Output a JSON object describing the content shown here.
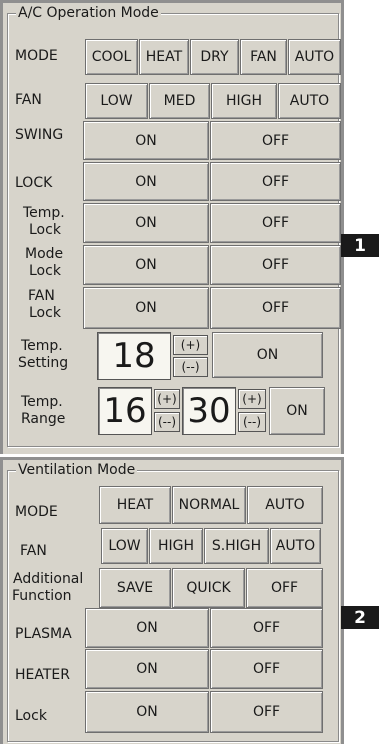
{
  "ac": {
    "title": "A/C Operation Mode",
    "mode": {
      "label": "MODE",
      "options": [
        "COOL",
        "HEAT",
        "DRY",
        "FAN",
        "AUTO"
      ]
    },
    "fan": {
      "label": "FAN",
      "options": [
        "LOW",
        "MED",
        "HIGH",
        "AUTO"
      ]
    },
    "swing": {
      "label": "SWING",
      "on": "ON",
      "off": "OFF"
    },
    "lock": {
      "label": "LOCK",
      "on": "ON",
      "off": "OFF"
    },
    "temp_lock": {
      "label1": "Temp.",
      "label2": "Lock",
      "on": "ON",
      "off": "OFF"
    },
    "mode_lock": {
      "label1": "Mode",
      "label2": "Lock",
      "on": "ON",
      "off": "OFF"
    },
    "fan_lock": {
      "label1": "FAN",
      "label2": "Lock",
      "on": "ON",
      "off": "OFF"
    },
    "temp_setting": {
      "label1": "Temp.",
      "label2": "Setting",
      "value": "18",
      "plus": "(+)",
      "minus": "(--)",
      "on": "ON"
    },
    "temp_range": {
      "label1": "Temp.",
      "label2": "Range",
      "low": "16",
      "high": "30",
      "plus": "(+)",
      "minus": "(--)",
      "on": "ON"
    }
  },
  "vent": {
    "title": "Ventilation Mode",
    "mode": {
      "label": "MODE",
      "options": [
        "HEAT",
        "NORMAL",
        "AUTO"
      ]
    },
    "fan": {
      "label": "FAN",
      "options": [
        "LOW",
        "HIGH",
        "S.HIGH",
        "AUTO"
      ]
    },
    "additional": {
      "label1": "Additional",
      "label2": "Function",
      "options": [
        "SAVE",
        "QUICK",
        "OFF"
      ]
    },
    "plasma": {
      "label": "PLASMA",
      "on": "ON",
      "off": "OFF"
    },
    "heater": {
      "label": "HEATER",
      "on": "ON",
      "off": "OFF"
    },
    "lock": {
      "label": "Lock",
      "on": "ON",
      "off": "OFF"
    }
  },
  "badges": {
    "one": "1",
    "two": "2"
  }
}
